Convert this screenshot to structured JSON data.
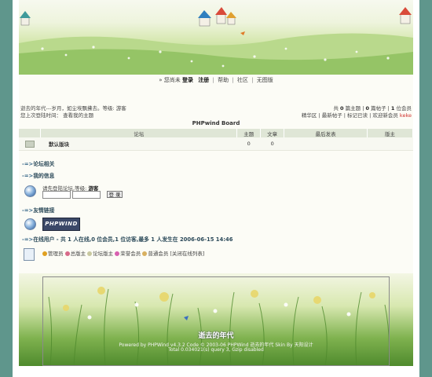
{
  "nav": {
    "prefix": "» 您尚未",
    "login": "登录",
    "register": "注册",
    "help": "帮助",
    "community": "社区",
    "no_image": "无图版",
    "separator": "|"
  },
  "welcome": {
    "line1": "逝去的年代---岁月，如尘埃飘拂去。等级: 游客",
    "line2": "您上次登陆时间：    查看我的主题"
  },
  "stats": {
    "count1": "0",
    "label1": "篇主题",
    "count2": "0",
    "label2": "篇帖子",
    "count3": "1",
    "label3": "位会员",
    "prefix": "共",
    "links": "精华区 | 最新帖子 | 标记已读 | 欢迎新会员",
    "new_member": "keke"
  },
  "board": {
    "title": "PHPwind Board",
    "columns": [
      "",
      "论坛",
      "主题",
      "文章",
      "最后发表",
      "版主"
    ],
    "rows": [
      {
        "name": "默认版块",
        "topics": "0",
        "posts": "0",
        "last": "",
        "moderator": ""
      }
    ]
  },
  "sections": {
    "forum_related": "论坛相关",
    "my_info": "我的信息",
    "friend_links": "友情链接",
    "online": "在线用户",
    "arrow": "-=>"
  },
  "login_box": {
    "prompt": "请先登陆论坛,等级:",
    "level": "游客",
    "button": "登 录"
  },
  "friend_link": {
    "logo_text": "PHPWIND"
  },
  "online": {
    "summary": "- 共  1 人在线,0 位会员,1 位访客,最多  1 人发生在  2006-06-15 14:46"
  },
  "legend": {
    "items": [
      "管理员",
      "总版主",
      "论坛版主",
      "荣誉会员",
      "普通会员"
    ],
    "close_list": "[关闭在线列表]"
  },
  "footer": {
    "logo": "逝去的年代",
    "line1": "Powered by PHPWind v4.3.2 Code © 2003-06 PHPWind  逝去的年代 Skin By 天阳设计",
    "line2": "Total 0.034021(s) query 3, Gzip disabled"
  },
  "colors": {
    "background": "#5f968c",
    "table_header": "#dfe6d6",
    "section_text": "#2c4a5a",
    "highlight": "#d0312d"
  }
}
